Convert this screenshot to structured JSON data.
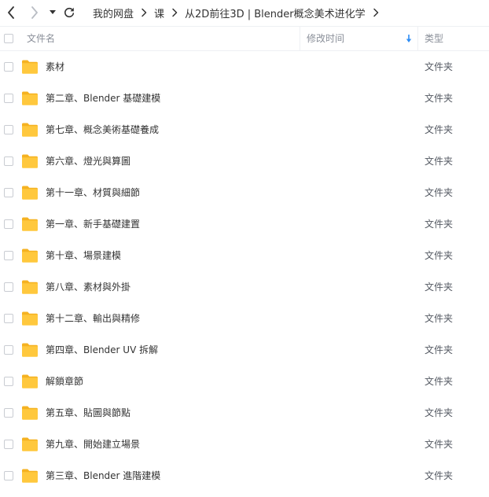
{
  "toolbar": {
    "back_icon": "chevron-left-icon",
    "forward_icon": "chevron-right-icon",
    "history_icon": "caret-down-icon",
    "refresh_icon": "refresh-icon"
  },
  "breadcrumb": [
    "我的网盘",
    "课",
    "从2D前往3D | Blender概念美术进化学"
  ],
  "table": {
    "columns": {
      "name": "文件名",
      "modified": "修改时间",
      "type": "类型"
    },
    "sort_icon": "sort-down-arrow-icon",
    "rows": [
      {
        "name": "素材",
        "type": "文件夹"
      },
      {
        "name": "第二章、Blender 基礎建模",
        "type": "文件夹"
      },
      {
        "name": "第七章、概念美術基礎養成",
        "type": "文件夹"
      },
      {
        "name": "第六章、燈光與算圖",
        "type": "文件夹"
      },
      {
        "name": "第十一章、材質與細節",
        "type": "文件夹"
      },
      {
        "name": "第一章、新手基礎建置",
        "type": "文件夹"
      },
      {
        "name": "第十章、場景建模",
        "type": "文件夹"
      },
      {
        "name": "第八章、素材與外掛",
        "type": "文件夹"
      },
      {
        "name": "第十二章、輸出與精修",
        "type": "文件夹"
      },
      {
        "name": "第四章、Blender UV 拆解",
        "type": "文件夹"
      },
      {
        "name": "解鎖章節",
        "type": "文件夹"
      },
      {
        "name": "第五章、貼圖與節點",
        "type": "文件夹"
      },
      {
        "name": "第九章、開始建立場景",
        "type": "文件夹"
      },
      {
        "name": "第三章、Blender 進階建模",
        "type": "文件夹"
      }
    ]
  },
  "colors": {
    "folder_yellow": "#ffc83d",
    "folder_dark": "#f5b221",
    "sort_arrow": "#2f8ef5",
    "text": "#333333",
    "header_text": "#8a8f99"
  }
}
